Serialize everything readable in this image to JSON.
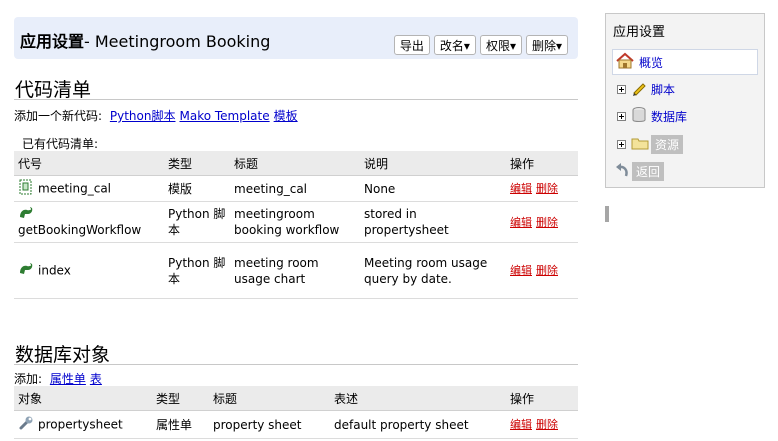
{
  "header": {
    "title_cn": "应用设置",
    "title_rest": "- Meetingroom Booking",
    "buttons": {
      "export": "导出",
      "rename": "改名▾",
      "perm": "权限▾",
      "delete": "删除▾"
    }
  },
  "code": {
    "section_title": "代码清单",
    "add_prefix": "添加一个新代码:",
    "add_links": [
      "Python脚本",
      "Mako Template",
      "模板"
    ],
    "existing_label": "已有代码清单:",
    "columns": [
      "代号",
      "类型",
      "标题",
      "说明",
      "操作"
    ],
    "rows": [
      {
        "icon": "template-icon",
        "name": "meeting_cal",
        "type": "模版",
        "title": "meeting_cal",
        "desc": "None",
        "edit": "编辑",
        "del": "删除"
      },
      {
        "icon": "python-icon",
        "name": "getBookingWorkflow",
        "type": "Python 脚本",
        "title": "meetingroom booking workflow",
        "desc": "stored in propertysheet",
        "edit": "编辑",
        "del": "删除"
      },
      {
        "icon": "python-icon",
        "name": "index",
        "type": "Python 脚本",
        "title": "meeting room usage chart",
        "desc": "Meeting room usage query by date.",
        "edit": "编辑",
        "del": "删除"
      }
    ]
  },
  "db": {
    "section_title": "数据库对象",
    "add_prefix": "添加:",
    "add_links": [
      "属性单",
      "表"
    ],
    "columns": [
      "对象",
      "类型",
      "标题",
      "表述",
      "操作"
    ],
    "rows": [
      {
        "icon": "wrench-icon",
        "name": "propertysheet",
        "type": "属性单",
        "title": "property sheet",
        "desc": "default property sheet",
        "edit": "编辑",
        "del": "删除"
      }
    ]
  },
  "sidebar": {
    "title": "应用设置",
    "items": [
      "概览",
      "脚本",
      "数据库",
      "资源",
      "返回"
    ]
  }
}
